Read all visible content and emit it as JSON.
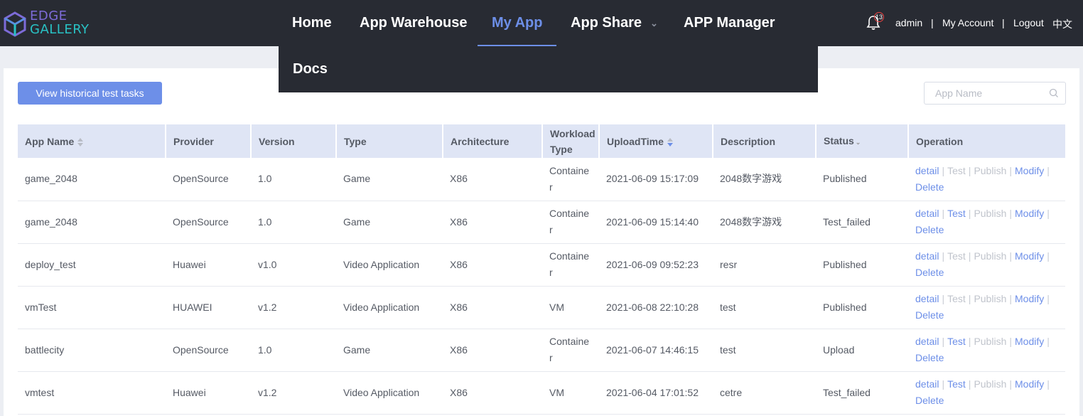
{
  "logo": {
    "line1": "EDGE",
    "line2": "GALLERY"
  },
  "nav": {
    "home": "Home",
    "warehouse": "App Warehouse",
    "my_app": "My App",
    "share": "App Share",
    "manager": "APP Manager",
    "docs": "Docs"
  },
  "header": {
    "notification_count": "13",
    "user": "admin",
    "my_account": "My Account",
    "logout": "Logout",
    "language": "中文",
    "separator": "|"
  },
  "toolbar": {
    "history_button": "View historical test tasks",
    "search_placeholder": "App Name"
  },
  "table": {
    "columns": [
      "App Name",
      "Provider",
      "Version",
      "Type",
      "Architecture",
      "Workload Type",
      "UploadTime",
      "Description",
      "Status",
      "Operation"
    ],
    "op_labels": {
      "detail": "detail",
      "test": "Test",
      "publish": "Publish",
      "modify": "Modify",
      "delete": "Delete"
    },
    "rows": [
      {
        "name": "game_2048",
        "provider": "OpenSource",
        "version": "1.0",
        "type": "Game",
        "arch": "X86",
        "workload": "Container",
        "upload": "2021-06-09 15:17:09",
        "desc": "2048数字游戏",
        "status": "Published",
        "test_enabled": false
      },
      {
        "name": "game_2048",
        "provider": "OpenSource",
        "version": "1.0",
        "type": "Game",
        "arch": "X86",
        "workload": "Container",
        "upload": "2021-06-09 15:14:40",
        "desc": "2048数字游戏",
        "status": "Test_failed",
        "test_enabled": true
      },
      {
        "name": "deploy_test",
        "provider": "Huawei",
        "version": "v1.0",
        "type": "Video Application",
        "arch": "X86",
        "workload": "Container",
        "upload": "2021-06-09 09:52:23",
        "desc": "resr",
        "status": "Published",
        "test_enabled": false
      },
      {
        "name": "vmTest",
        "provider": "HUAWEI",
        "version": "v1.2",
        "type": "Video Application",
        "arch": "X86",
        "workload": "VM",
        "upload": "2021-06-08 22:10:28",
        "desc": "test",
        "status": "Published",
        "test_enabled": false
      },
      {
        "name": "battlecity",
        "provider": "OpenSource",
        "version": "1.0",
        "type": "Game",
        "arch": "X86",
        "workload": "Container",
        "upload": "2021-06-07 14:46:15",
        "desc": "test",
        "status": "Upload",
        "test_enabled": true
      },
      {
        "name": "vmtest",
        "provider": "Huawei",
        "version": "v1.2",
        "type": "Video Application",
        "arch": "X86",
        "workload": "VM",
        "upload": "2021-06-04 17:01:52",
        "desc": "cetre",
        "status": "Test_failed",
        "test_enabled": true
      }
    ]
  },
  "colors": {
    "accent": "#6d8fe8",
    "header_bg": "#282b33",
    "logo_purple": "#7d6bd8",
    "logo_teal": "#29c2c5"
  }
}
